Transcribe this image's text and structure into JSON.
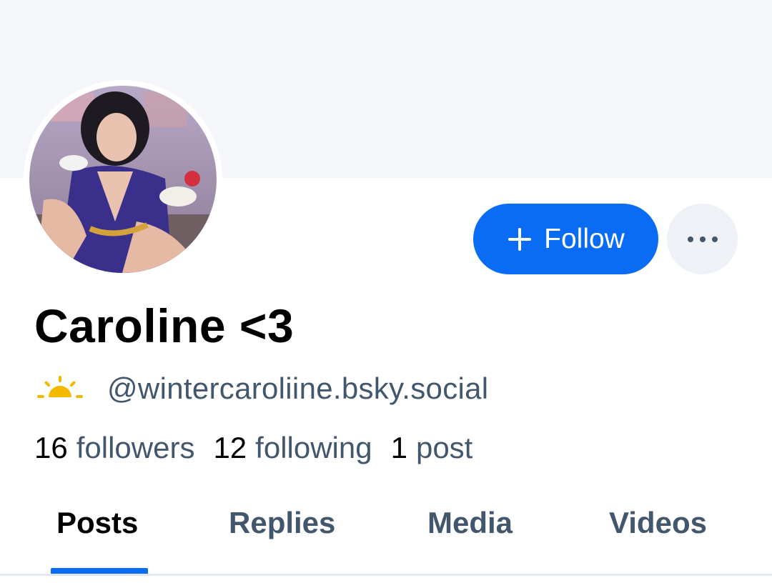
{
  "profile": {
    "display_name": "Caroline <3",
    "handle": "@wintercaroliine.bsky.social",
    "avatar_icon": "avatar-photo",
    "status_icon": "sun-icon"
  },
  "actions": {
    "follow_label": "Follow",
    "follow_icon": "plus-icon",
    "more_icon": "more-dots-icon"
  },
  "stats": [
    {
      "count": "16",
      "label": "followers"
    },
    {
      "count": "12",
      "label": "following"
    },
    {
      "count": "1",
      "label": "post"
    }
  ],
  "tabs": [
    {
      "label": "Posts",
      "active": true
    },
    {
      "label": "Replies",
      "active": false
    },
    {
      "label": "Media",
      "active": false
    },
    {
      "label": "Videos",
      "active": false
    }
  ],
  "colors": {
    "accent": "#0a6cf5",
    "banner": "#f4f6f9",
    "muted_text": "#42576c",
    "more_button_bg": "#eef1f5",
    "sun": "#f5b800"
  }
}
